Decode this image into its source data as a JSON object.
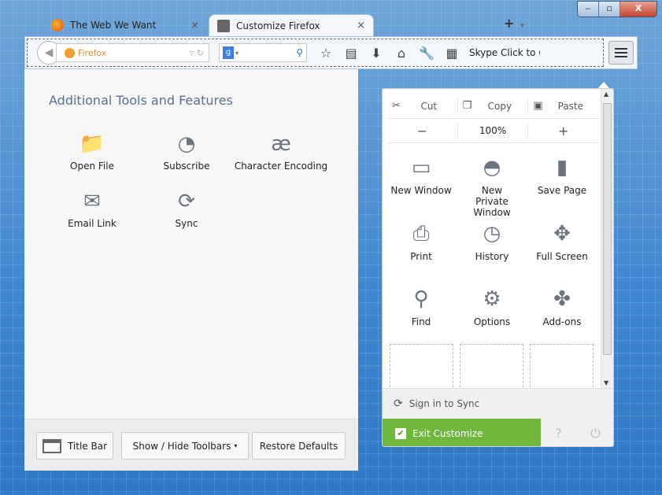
{
  "window": {
    "minimize": "‒",
    "maximize": "▫",
    "close": "X"
  },
  "tabs": [
    {
      "title": "The Web We Want",
      "close": "×"
    },
    {
      "title": "Customize Firefox",
      "close": "×"
    }
  ],
  "new_tab": "+",
  "tab_list": "▾",
  "toolbar": {
    "url_placeholder": "Firefox",
    "search_engine": "g",
    "items": [
      "☆",
      "▤",
      "⬇",
      "⌂",
      "🔧",
      "▦"
    ],
    "skype": "Skype Click to Ca"
  },
  "palette": {
    "title": "Additional Tools and Features",
    "tools": [
      {
        "label": "Open File",
        "icon": "folder-icon"
      },
      {
        "label": "Subscribe",
        "icon": "rss-icon"
      },
      {
        "label": "Character Encoding",
        "icon": "ae-icon"
      },
      {
        "label": "Email Link",
        "icon": "envelope-icon"
      },
      {
        "label": "Sync",
        "icon": "sync-icon"
      }
    ]
  },
  "footer": {
    "title_bar": "Title Bar",
    "show_hide": "Show / Hide Toolbars",
    "restore": "Restore Defaults"
  },
  "menu": {
    "cut": "Cut",
    "copy": "Copy",
    "paste": "Paste",
    "zoom_out": "−",
    "zoom": "100%",
    "zoom_in": "+",
    "items": [
      {
        "label": "New Window"
      },
      {
        "label": "New Private Window"
      },
      {
        "label": "Save Page"
      },
      {
        "label": "Print"
      },
      {
        "label": "History"
      },
      {
        "label": "Full Screen"
      },
      {
        "label": "Find"
      },
      {
        "label": "Options"
      },
      {
        "label": "Add-ons"
      }
    ],
    "sign_in": "Sign in to Sync",
    "exit": "Exit Customize",
    "exit_color": "#70b73d"
  }
}
